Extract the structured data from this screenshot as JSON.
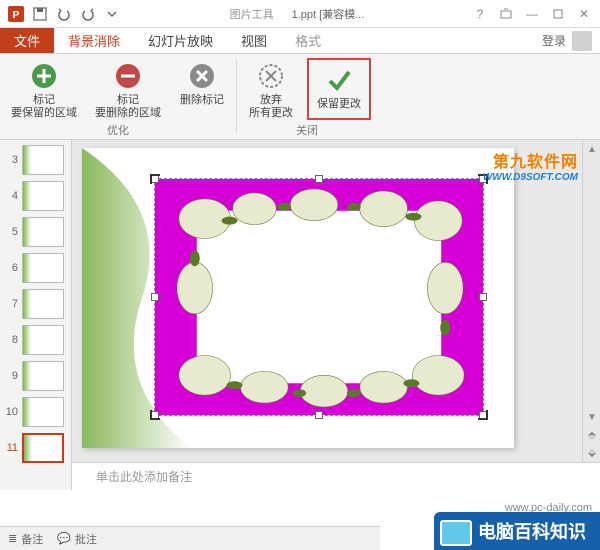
{
  "titlebar": {
    "context_tab_group": "图片工具",
    "document_title": "1.ppt [兼容模..."
  },
  "tabs": {
    "file": "文件",
    "bg_remove": "背景消除",
    "slideshow": "幻灯片放映",
    "view": "视图",
    "format": "格式",
    "signin": "登录"
  },
  "ribbon": {
    "mark_keep": {
      "l1": "标记",
      "l2": "要保留的区域"
    },
    "mark_remove": {
      "l1": "标记",
      "l2": "要删除的区域"
    },
    "delete_mark": {
      "l1": "删除标记",
      "l2": ""
    },
    "discard": {
      "l1": "放弃",
      "l2": "所有更改"
    },
    "keep": {
      "l1": "保留更改",
      "l2": ""
    },
    "group_refine": "优化",
    "group_close": "关闭"
  },
  "thumbs": [
    {
      "n": "3"
    },
    {
      "n": "4"
    },
    {
      "n": "5"
    },
    {
      "n": "6"
    },
    {
      "n": "7"
    },
    {
      "n": "8"
    },
    {
      "n": "9"
    },
    {
      "n": "10"
    },
    {
      "n": "11"
    }
  ],
  "selected_thumb": "11",
  "notes_placeholder": "单击此处添加备注",
  "statusbar": {
    "notes": "备注",
    "comments": "批注"
  },
  "watermarks": {
    "top_right_l1": "第九软件网",
    "top_right_l2": "WWW.D9SOFT.COM",
    "bottom_right": "电脑百科知识",
    "bottom_right_sub": "www.pc-daily.com"
  },
  "colors": {
    "accent": "#c43e1c",
    "magenta": "#d600d6",
    "mark_plus": "#4a9a4a",
    "mark_minus": "#c04848"
  }
}
